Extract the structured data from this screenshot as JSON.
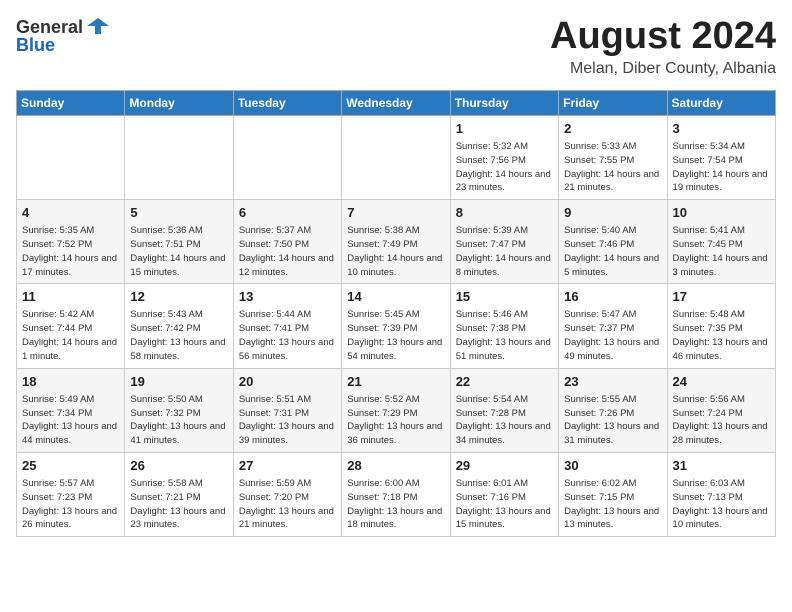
{
  "logo": {
    "general": "General",
    "blue": "Blue"
  },
  "header": {
    "month_year": "August 2024",
    "location": "Melan, Diber County, Albania"
  },
  "days_of_week": [
    "Sunday",
    "Monday",
    "Tuesday",
    "Wednesday",
    "Thursday",
    "Friday",
    "Saturday"
  ],
  "weeks": [
    [
      {
        "day": "",
        "info": ""
      },
      {
        "day": "",
        "info": ""
      },
      {
        "day": "",
        "info": ""
      },
      {
        "day": "",
        "info": ""
      },
      {
        "day": "1",
        "info": "Sunrise: 5:32 AM\nSunset: 7:56 PM\nDaylight: 14 hours and 23 minutes."
      },
      {
        "day": "2",
        "info": "Sunrise: 5:33 AM\nSunset: 7:55 PM\nDaylight: 14 hours and 21 minutes."
      },
      {
        "day": "3",
        "info": "Sunrise: 5:34 AM\nSunset: 7:54 PM\nDaylight: 14 hours and 19 minutes."
      }
    ],
    [
      {
        "day": "4",
        "info": "Sunrise: 5:35 AM\nSunset: 7:52 PM\nDaylight: 14 hours and 17 minutes."
      },
      {
        "day": "5",
        "info": "Sunrise: 5:36 AM\nSunset: 7:51 PM\nDaylight: 14 hours and 15 minutes."
      },
      {
        "day": "6",
        "info": "Sunrise: 5:37 AM\nSunset: 7:50 PM\nDaylight: 14 hours and 12 minutes."
      },
      {
        "day": "7",
        "info": "Sunrise: 5:38 AM\nSunset: 7:49 PM\nDaylight: 14 hours and 10 minutes."
      },
      {
        "day": "8",
        "info": "Sunrise: 5:39 AM\nSunset: 7:47 PM\nDaylight: 14 hours and 8 minutes."
      },
      {
        "day": "9",
        "info": "Sunrise: 5:40 AM\nSunset: 7:46 PM\nDaylight: 14 hours and 5 minutes."
      },
      {
        "day": "10",
        "info": "Sunrise: 5:41 AM\nSunset: 7:45 PM\nDaylight: 14 hours and 3 minutes."
      }
    ],
    [
      {
        "day": "11",
        "info": "Sunrise: 5:42 AM\nSunset: 7:44 PM\nDaylight: 14 hours and 1 minute."
      },
      {
        "day": "12",
        "info": "Sunrise: 5:43 AM\nSunset: 7:42 PM\nDaylight: 13 hours and 58 minutes."
      },
      {
        "day": "13",
        "info": "Sunrise: 5:44 AM\nSunset: 7:41 PM\nDaylight: 13 hours and 56 minutes."
      },
      {
        "day": "14",
        "info": "Sunrise: 5:45 AM\nSunset: 7:39 PM\nDaylight: 13 hours and 54 minutes."
      },
      {
        "day": "15",
        "info": "Sunrise: 5:46 AM\nSunset: 7:38 PM\nDaylight: 13 hours and 51 minutes."
      },
      {
        "day": "16",
        "info": "Sunrise: 5:47 AM\nSunset: 7:37 PM\nDaylight: 13 hours and 49 minutes."
      },
      {
        "day": "17",
        "info": "Sunrise: 5:48 AM\nSunset: 7:35 PM\nDaylight: 13 hours and 46 minutes."
      }
    ],
    [
      {
        "day": "18",
        "info": "Sunrise: 5:49 AM\nSunset: 7:34 PM\nDaylight: 13 hours and 44 minutes."
      },
      {
        "day": "19",
        "info": "Sunrise: 5:50 AM\nSunset: 7:32 PM\nDaylight: 13 hours and 41 minutes."
      },
      {
        "day": "20",
        "info": "Sunrise: 5:51 AM\nSunset: 7:31 PM\nDaylight: 13 hours and 39 minutes."
      },
      {
        "day": "21",
        "info": "Sunrise: 5:52 AM\nSunset: 7:29 PM\nDaylight: 13 hours and 36 minutes."
      },
      {
        "day": "22",
        "info": "Sunrise: 5:54 AM\nSunset: 7:28 PM\nDaylight: 13 hours and 34 minutes."
      },
      {
        "day": "23",
        "info": "Sunrise: 5:55 AM\nSunset: 7:26 PM\nDaylight: 13 hours and 31 minutes."
      },
      {
        "day": "24",
        "info": "Sunrise: 5:56 AM\nSunset: 7:24 PM\nDaylight: 13 hours and 28 minutes."
      }
    ],
    [
      {
        "day": "25",
        "info": "Sunrise: 5:57 AM\nSunset: 7:23 PM\nDaylight: 13 hours and 26 minutes."
      },
      {
        "day": "26",
        "info": "Sunrise: 5:58 AM\nSunset: 7:21 PM\nDaylight: 13 hours and 23 minutes."
      },
      {
        "day": "27",
        "info": "Sunrise: 5:59 AM\nSunset: 7:20 PM\nDaylight: 13 hours and 21 minutes."
      },
      {
        "day": "28",
        "info": "Sunrise: 6:00 AM\nSunset: 7:18 PM\nDaylight: 13 hours and 18 minutes."
      },
      {
        "day": "29",
        "info": "Sunrise: 6:01 AM\nSunset: 7:16 PM\nDaylight: 13 hours and 15 minutes."
      },
      {
        "day": "30",
        "info": "Sunrise: 6:02 AM\nSunset: 7:15 PM\nDaylight: 13 hours and 13 minutes."
      },
      {
        "day": "31",
        "info": "Sunrise: 6:03 AM\nSunset: 7:13 PM\nDaylight: 13 hours and 10 minutes."
      }
    ]
  ]
}
